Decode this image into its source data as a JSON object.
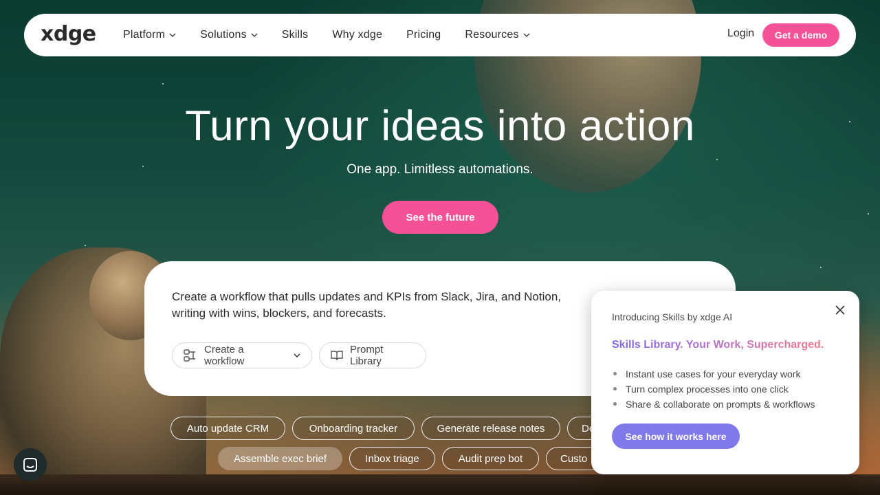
{
  "brand": {
    "logo": "xdge",
    "accent": "#f45196",
    "popup_accent": "#8079ea"
  },
  "nav": {
    "items": [
      {
        "label": "Platform",
        "dropdown": true
      },
      {
        "label": "Solutions",
        "dropdown": true
      },
      {
        "label": "Skills",
        "dropdown": false
      },
      {
        "label": "Why xdge",
        "dropdown": false
      },
      {
        "label": "Pricing",
        "dropdown": false
      },
      {
        "label": "Resources",
        "dropdown": true
      }
    ],
    "login": "Login",
    "demo": "Get a demo"
  },
  "hero": {
    "title": "Turn your ideas into action",
    "subtitle": "One app. Limitless automations.",
    "cta": "See the future"
  },
  "prompt": {
    "text": "Create a workflow that pulls updates and KPIs from Slack, Jira, and Notion, writing with wins, blockers, and forecasts.",
    "workflow_button": "Create a workflow",
    "library_button": "Prompt Library"
  },
  "chips": {
    "row1": [
      "Auto update CRM",
      "Onboarding tracker",
      "Generate release notes",
      "De"
    ],
    "row2": [
      "Assemble exec brief",
      "Inbox triage",
      "Audit prep bot",
      "Custo"
    ]
  },
  "popup": {
    "intro": "Introducing Skills by xdge AI",
    "headline": "Skills Library. Your Work, Supercharged.",
    "bullets": [
      "Instant use cases for your everyday work",
      "Turn complex processes into one click",
      "Share & collaborate on prompts & workflows"
    ],
    "button": "See how it works here"
  },
  "icons": [
    "chevron-down-icon",
    "workflow-icon",
    "book-icon",
    "close-icon",
    "chat-icon"
  ]
}
